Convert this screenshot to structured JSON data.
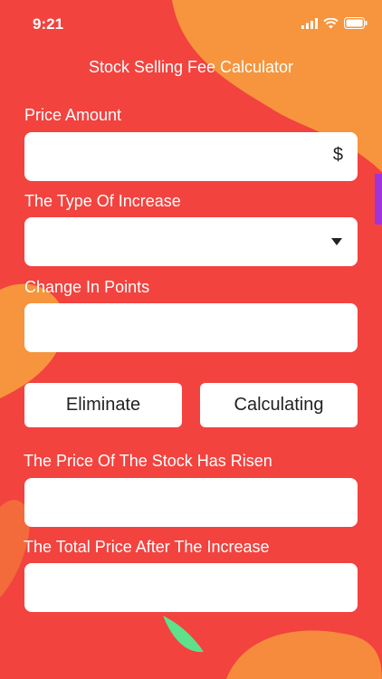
{
  "status_bar": {
    "time": "9:21",
    "icons": [
      "signal-icon",
      "wifi-icon",
      "battery-icon"
    ]
  },
  "app": {
    "title": "Stock Selling Fee Calculator"
  },
  "form": {
    "price_amount": {
      "label": "Price Amount",
      "value": "",
      "suffix": "$"
    },
    "increase_type": {
      "label": "The Type Of Increase",
      "selected": ""
    },
    "change_points": {
      "label": "Change In Points",
      "value": ""
    },
    "buttons": {
      "eliminate": "Eliminate",
      "calculating": "Calculating"
    },
    "risen_price": {
      "label": "The Price Of The Stock Has Risen",
      "value": ""
    },
    "total_price": {
      "label": "The Total Price After The Increase",
      "value": ""
    }
  },
  "colors": {
    "background": "#f2433f",
    "accent_orange": "#f99a3a",
    "accent_green": "#5fe08a",
    "accent_purple": "#a233d8"
  }
}
